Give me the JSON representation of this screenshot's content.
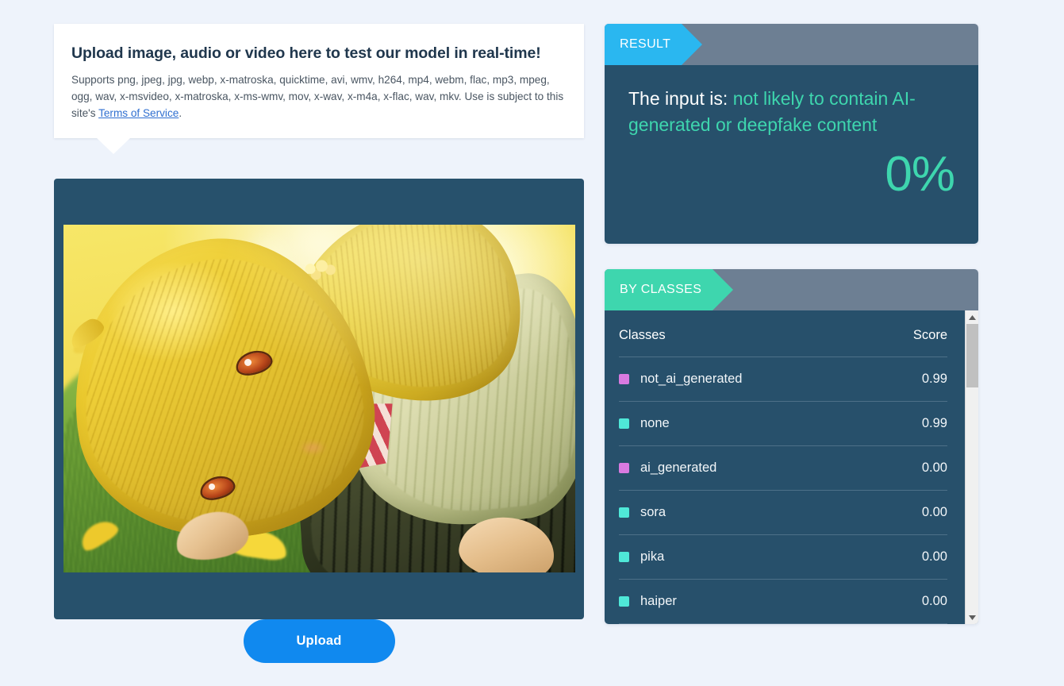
{
  "upload_hint": {
    "title": "Upload image, audio or video here to test our model in real-time!",
    "supports_text": "Supports png, jpeg, jpg, webp, x-matroska, quicktime, avi, wmv, h264, mp4, webm, flac, mp3, mpeg, ogg, wav, x-msvideo, x-matroska, x-ms-wmv, mov, x-wav, x-m4a, x-flac, wav, mkv. Use is subject to this site's ",
    "terms_link": "Terms of Service",
    "supports_suffix": "."
  },
  "upload_button": {
    "label": "Upload"
  },
  "result_panel": {
    "tab_label": "RESULT",
    "prefix": "The input is: ",
    "verdict": "not likely to contain AI-generated or deepfake content",
    "percent": "0%",
    "accent_color": "#3ed6ae",
    "tab_color": "#2ab7f0"
  },
  "classes_panel": {
    "tab_label": "BY CLASSES",
    "tab_color": "#3ed6ae",
    "columns": {
      "class": "Classes",
      "score": "Score"
    },
    "rows": [
      {
        "name": "not_ai_generated",
        "score": "0.99",
        "color": "#d97ae0"
      },
      {
        "name": "none",
        "score": "0.99",
        "color": "#4fe8d8"
      },
      {
        "name": "ai_generated",
        "score": "0.00",
        "color": "#d97ae0"
      },
      {
        "name": "sora",
        "score": "0.00",
        "color": "#4fe8d8"
      },
      {
        "name": "pika",
        "score": "0.00",
        "color": "#4fe8d8"
      },
      {
        "name": "haiper",
        "score": "0.00",
        "color": "#4fe8d8"
      }
    ]
  },
  "preview": {
    "alt": "anime illustration of a blonde girl lying in sunlit grass with ginkgo leaves"
  },
  "theme": {
    "page_bg": "#eef3fb",
    "panel_bg": "#27506b",
    "header_bg": "#6d7f93"
  }
}
